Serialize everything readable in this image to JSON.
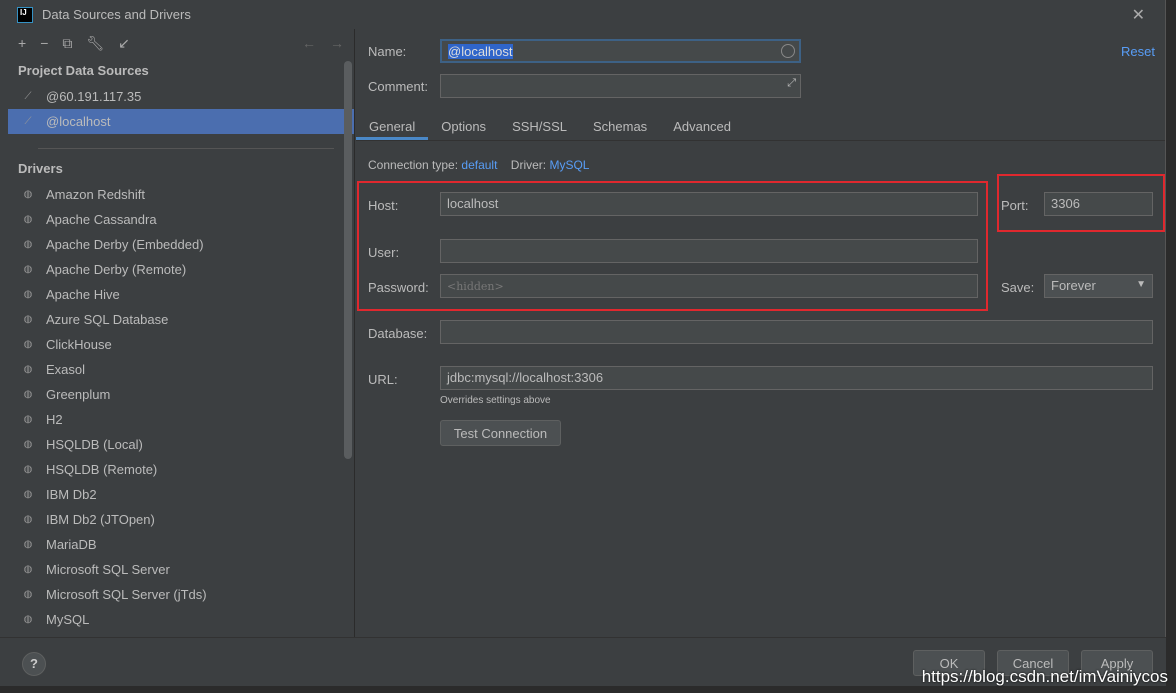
{
  "window": {
    "title": "Data Sources and Drivers",
    "logo": "IJ"
  },
  "left": {
    "section_project": "Project Data Sources",
    "project_sources": [
      {
        "label": "@60.191.117.35"
      },
      {
        "label": "@localhost"
      }
    ],
    "section_drivers": "Drivers",
    "drivers": [
      "Amazon Redshift",
      "Apache Cassandra",
      "Apache Derby (Embedded)",
      "Apache Derby (Remote)",
      "Apache Hive",
      "Azure SQL Database",
      "ClickHouse",
      "Exasol",
      "Greenplum",
      "H2",
      "HSQLDB (Local)",
      "HSQLDB (Remote)",
      "IBM Db2",
      "IBM Db2 (JTOpen)",
      "MariaDB",
      "Microsoft SQL Server",
      "Microsoft SQL Server (jTds)",
      "MySQL"
    ]
  },
  "form": {
    "name_label": "Name:",
    "name_value": "@localhost",
    "comment_label": "Comment:",
    "reset": "Reset",
    "tabs": [
      "General",
      "Options",
      "SSH/SSL",
      "Schemas",
      "Advanced"
    ],
    "conn_type_label": "Connection type:",
    "conn_type": "default",
    "driver_label": "Driver:",
    "driver": "MySQL",
    "host_label": "Host:",
    "host": "localhost",
    "port_label": "Port:",
    "port": "3306",
    "user_label": "User:",
    "user": "",
    "password_label": "Password:",
    "password_placeholder": "<hidden>",
    "save_label": "Save:",
    "save": "Forever",
    "database_label": "Database:",
    "database": "",
    "url_label": "URL:",
    "url": "jdbc:mysql://localhost:3306",
    "url_hint": "Overrides settings above",
    "test_connection": "Test Connection"
  },
  "footer": {
    "help": "?",
    "ok": "OK",
    "cancel": "Cancel",
    "apply": "Apply"
  },
  "watermark": "https://blog.csdn.net/imVainiycos",
  "colors": {
    "selection": "#4b6eaf",
    "link": "#589df6",
    "highlight_box": "#e0282e"
  }
}
